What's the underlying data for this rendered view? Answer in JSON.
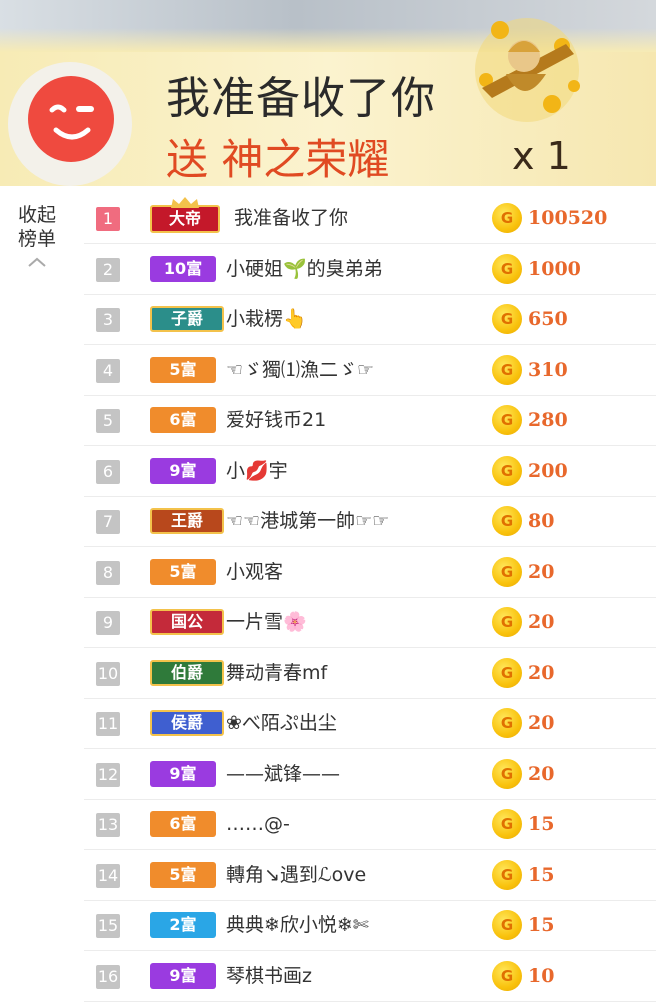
{
  "banner": {
    "sender": "我准备收了你",
    "gift_line": "送 神之荣耀",
    "gift_count": "x 1",
    "gift_icon": "golden-hero-gift-icon",
    "avatar_icon": "winking-face-icon"
  },
  "collapse": {
    "line1": "收起",
    "line2": "榜单",
    "icon": "chevron-up-icon"
  },
  "colors": {
    "badge_orange": "#f08c2c",
    "badge_purple": "#9a3be0",
    "badge_blue": "#2aa6e6",
    "rank_first": "#f06c7f",
    "amount": "#e8682c",
    "gift_text": "#e04a22"
  },
  "ranking": [
    {
      "rank": "1",
      "badge": "大帝",
      "badge_style": "emperor",
      "name": "我准备收了你",
      "coin": "G",
      "amount": "100520"
    },
    {
      "rank": "2",
      "badge": "10富",
      "badge_style": "purple",
      "name": "小硬姐🌱的臭弟弟",
      "coin": "G",
      "amount": "1000"
    },
    {
      "rank": "3",
      "badge": "子爵",
      "badge_style": "teal-noble",
      "name": "小栽楞👆",
      "coin": "G",
      "amount": "650"
    },
    {
      "rank": "4",
      "badge": "5富",
      "badge_style": "orange",
      "name": "☜ゞ獨⑴漁二ゞ☞",
      "coin": "G",
      "amount": "310"
    },
    {
      "rank": "5",
      "badge": "6富",
      "badge_style": "orange",
      "name": "爱好钱币21",
      "coin": "G",
      "amount": "280"
    },
    {
      "rank": "6",
      "badge": "9富",
      "badge_style": "purple",
      "name": "小💋宇",
      "coin": "G",
      "amount": "200"
    },
    {
      "rank": "7",
      "badge": "王爵",
      "badge_style": "brown-noble",
      "name": "☜☜港城第一帥☞☞",
      "coin": "G",
      "amount": "80"
    },
    {
      "rank": "8",
      "badge": "5富",
      "badge_style": "orange",
      "name": "小观客",
      "coin": "G",
      "amount": "20"
    },
    {
      "rank": "9",
      "badge": "国公",
      "badge_style": "red-noble",
      "name": "一片雪🌸",
      "coin": "G",
      "amount": "20"
    },
    {
      "rank": "10",
      "badge": "伯爵",
      "badge_style": "green-noble",
      "name": "舞动青春mf",
      "coin": "G",
      "amount": "20"
    },
    {
      "rank": "11",
      "badge": "侯爵",
      "badge_style": "blue-noble",
      "name": "❀べ陌ぷ出尘",
      "coin": "G",
      "amount": "20"
    },
    {
      "rank": "12",
      "badge": "9富",
      "badge_style": "purple",
      "name": "——斌锋——",
      "coin": "G",
      "amount": "20"
    },
    {
      "rank": "13",
      "badge": "6富",
      "badge_style": "orange",
      "name": "……@-",
      "coin": "G",
      "amount": "15"
    },
    {
      "rank": "14",
      "badge": "5富",
      "badge_style": "orange",
      "name": "轉角↘遇到ℒove",
      "coin": "G",
      "amount": "15"
    },
    {
      "rank": "15",
      "badge": "2富",
      "badge_style": "blue",
      "name": "典典❄欣小悦❄✄",
      "coin": "G",
      "amount": "15"
    },
    {
      "rank": "16",
      "badge": "9富",
      "badge_style": "purple",
      "name": "琴棋书画z",
      "coin": "G",
      "amount": "10"
    }
  ]
}
